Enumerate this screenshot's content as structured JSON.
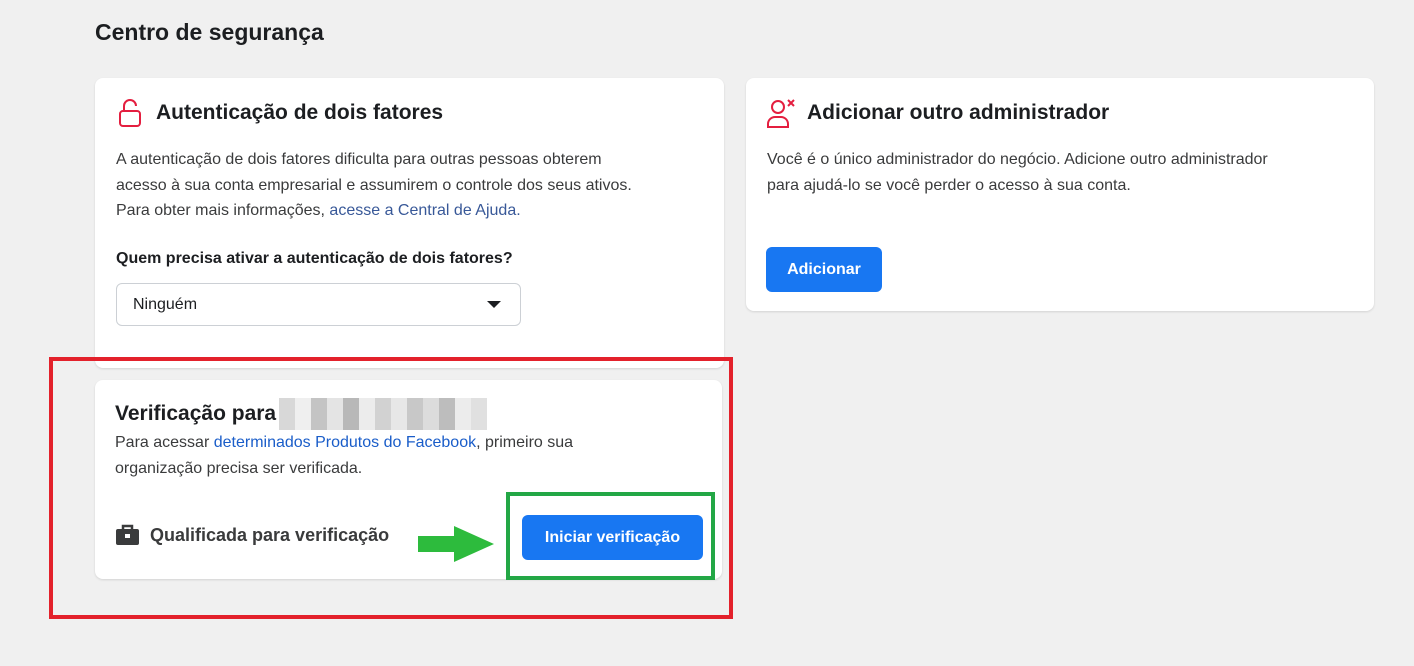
{
  "page": {
    "title": "Centro de segurança"
  },
  "two_factor_card": {
    "title": "Autenticação de dois fatores",
    "icon": "unlocked-padlock-icon",
    "description_line1": "A autenticação de dois fatores dificulta para outras pessoas obterem",
    "description_line2": "acesso à sua conta empresarial e assumirem o controle dos seus ativos.",
    "description_line3_prefix": "Para obter mais informações, ",
    "help_link": "acesse a Central de Ajuda",
    "help_link_suffix": ".",
    "question": "Quem precisa ativar a autenticação de dois fatores?",
    "select_value": "Ninguém"
  },
  "admin_card": {
    "title": "Adicionar outro administrador",
    "icon": "remove-person-icon",
    "description_line1": "Você é o único administrador do negócio. Adicione outro administrador",
    "description_line2": "para ajudá-lo se você perder o acesso à sua conta.",
    "button_label": "Adicionar"
  },
  "verification_card": {
    "title_prefix": "Verificação para",
    "text_prefix": "Para acessar ",
    "products_link": "determinados Produtos do Facebook",
    "text_suffix_line1": ", primeiro sua",
    "text_line2": "organização precisa ser verificada.",
    "status_icon": "briefcase-icon",
    "status_label": "Qualificada para verificação",
    "button_label": "Iniciar verificação"
  },
  "colors": {
    "primary": "#1877f2",
    "link": "#385898",
    "icon_red": "#e41e3f",
    "annotation_red": "#e3212b",
    "annotation_green": "#23a745"
  }
}
